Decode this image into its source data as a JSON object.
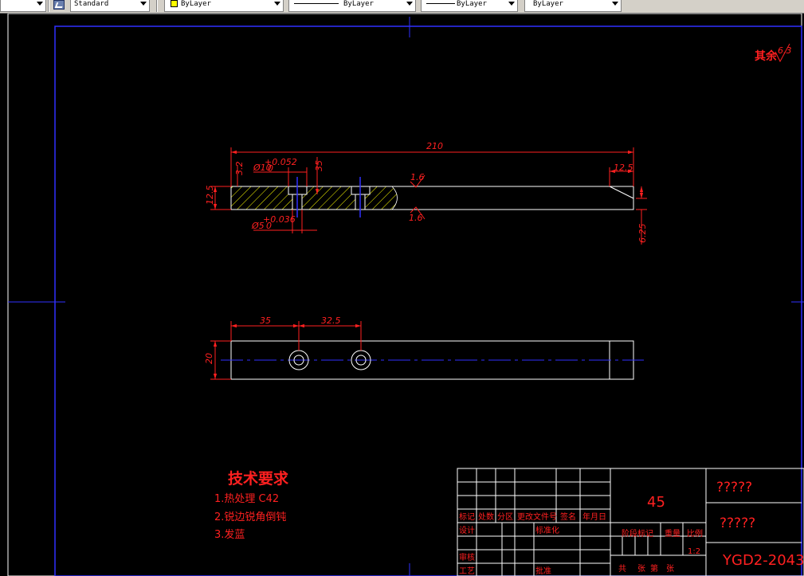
{
  "toolbar": {
    "text_style": "Standard",
    "layer_color": "ByLayer",
    "linetype": "ByLayer",
    "lineweight": "ByLayer",
    "plot_style": "ByLayer",
    "layer_color_swatch": "#ffff00"
  },
  "drawing": {
    "roughness_label": "其余",
    "roughness_value": "6.3",
    "dims": {
      "overall_length": "210",
      "end_chamfer": "12.5",
      "height_left": "12.5",
      "top_small": "3.2",
      "top_35": "35",
      "hole_top_label": "Ø10",
      "hole_top_tol": "+0.052",
      "hole_top_tol_low": "0",
      "hole_bottom_label": "Ø5",
      "hole_bottom_tol": "+0.036",
      "hole_bottom_tol_low": "0",
      "roughness_a": "1.6",
      "roughness_b": "1.6",
      "right_625": "6.25",
      "plan_35": "35",
      "plan_325": "32.5",
      "plan_20": "20"
    },
    "tech_req": {
      "title": "技术要求",
      "items": [
        "1.热处理 C42",
        "2.锐边锐角倒钝",
        "3.发蓝"
      ]
    },
    "title_block": {
      "material": "45",
      "part_name_1": "?????",
      "part_name_2": "?????",
      "drawing_no": "YGD2-2043",
      "scale": "1:2",
      "headers": [
        "标记",
        "处数",
        "分区",
        "更改文件号",
        "签名",
        "年月日"
      ],
      "designer": "设计",
      "standardize": "标准化",
      "stage_mark": "阶段标记",
      "weight": "重量",
      "ratio": "比例",
      "review": "审核",
      "process": "工艺",
      "approve": "批准",
      "sheets_total": "共",
      "sheets_label": "张",
      "sheet_no": "第",
      "sheet_label": "张"
    }
  }
}
